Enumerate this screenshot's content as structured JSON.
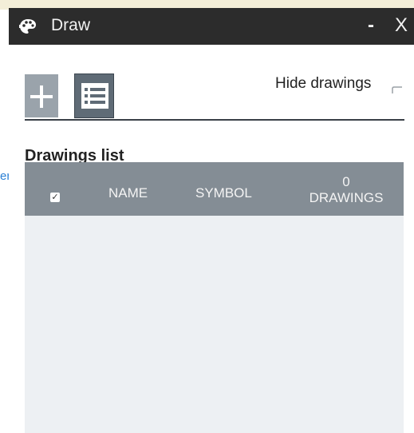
{
  "background": {
    "link_fragment": "er"
  },
  "panel": {
    "title": "Draw",
    "title_icon": "palette-icon",
    "controls": {
      "minimize_label": "-",
      "close_label": "X"
    },
    "tabs": [
      {
        "id": "add",
        "icon": "plus-icon",
        "active": false
      },
      {
        "id": "list",
        "icon": "list-icon",
        "active": true
      }
    ],
    "hide_drawings_label": "Hide drawings",
    "hide_drawings_checked": false,
    "list_heading": "Drawings list",
    "table": {
      "select_all_checked": true,
      "columns": {
        "name": "NAME",
        "symbol": "SYMBOL",
        "count_value": "0",
        "count_label": "DRAWINGS"
      },
      "rows": []
    }
  },
  "colors": {
    "titlebar": "#2c2c2c",
    "tab_active": "#5f6b76",
    "tab_inactive": "#9aa3ab",
    "table_header": "#848d95",
    "table_body": "#edf0f3"
  }
}
